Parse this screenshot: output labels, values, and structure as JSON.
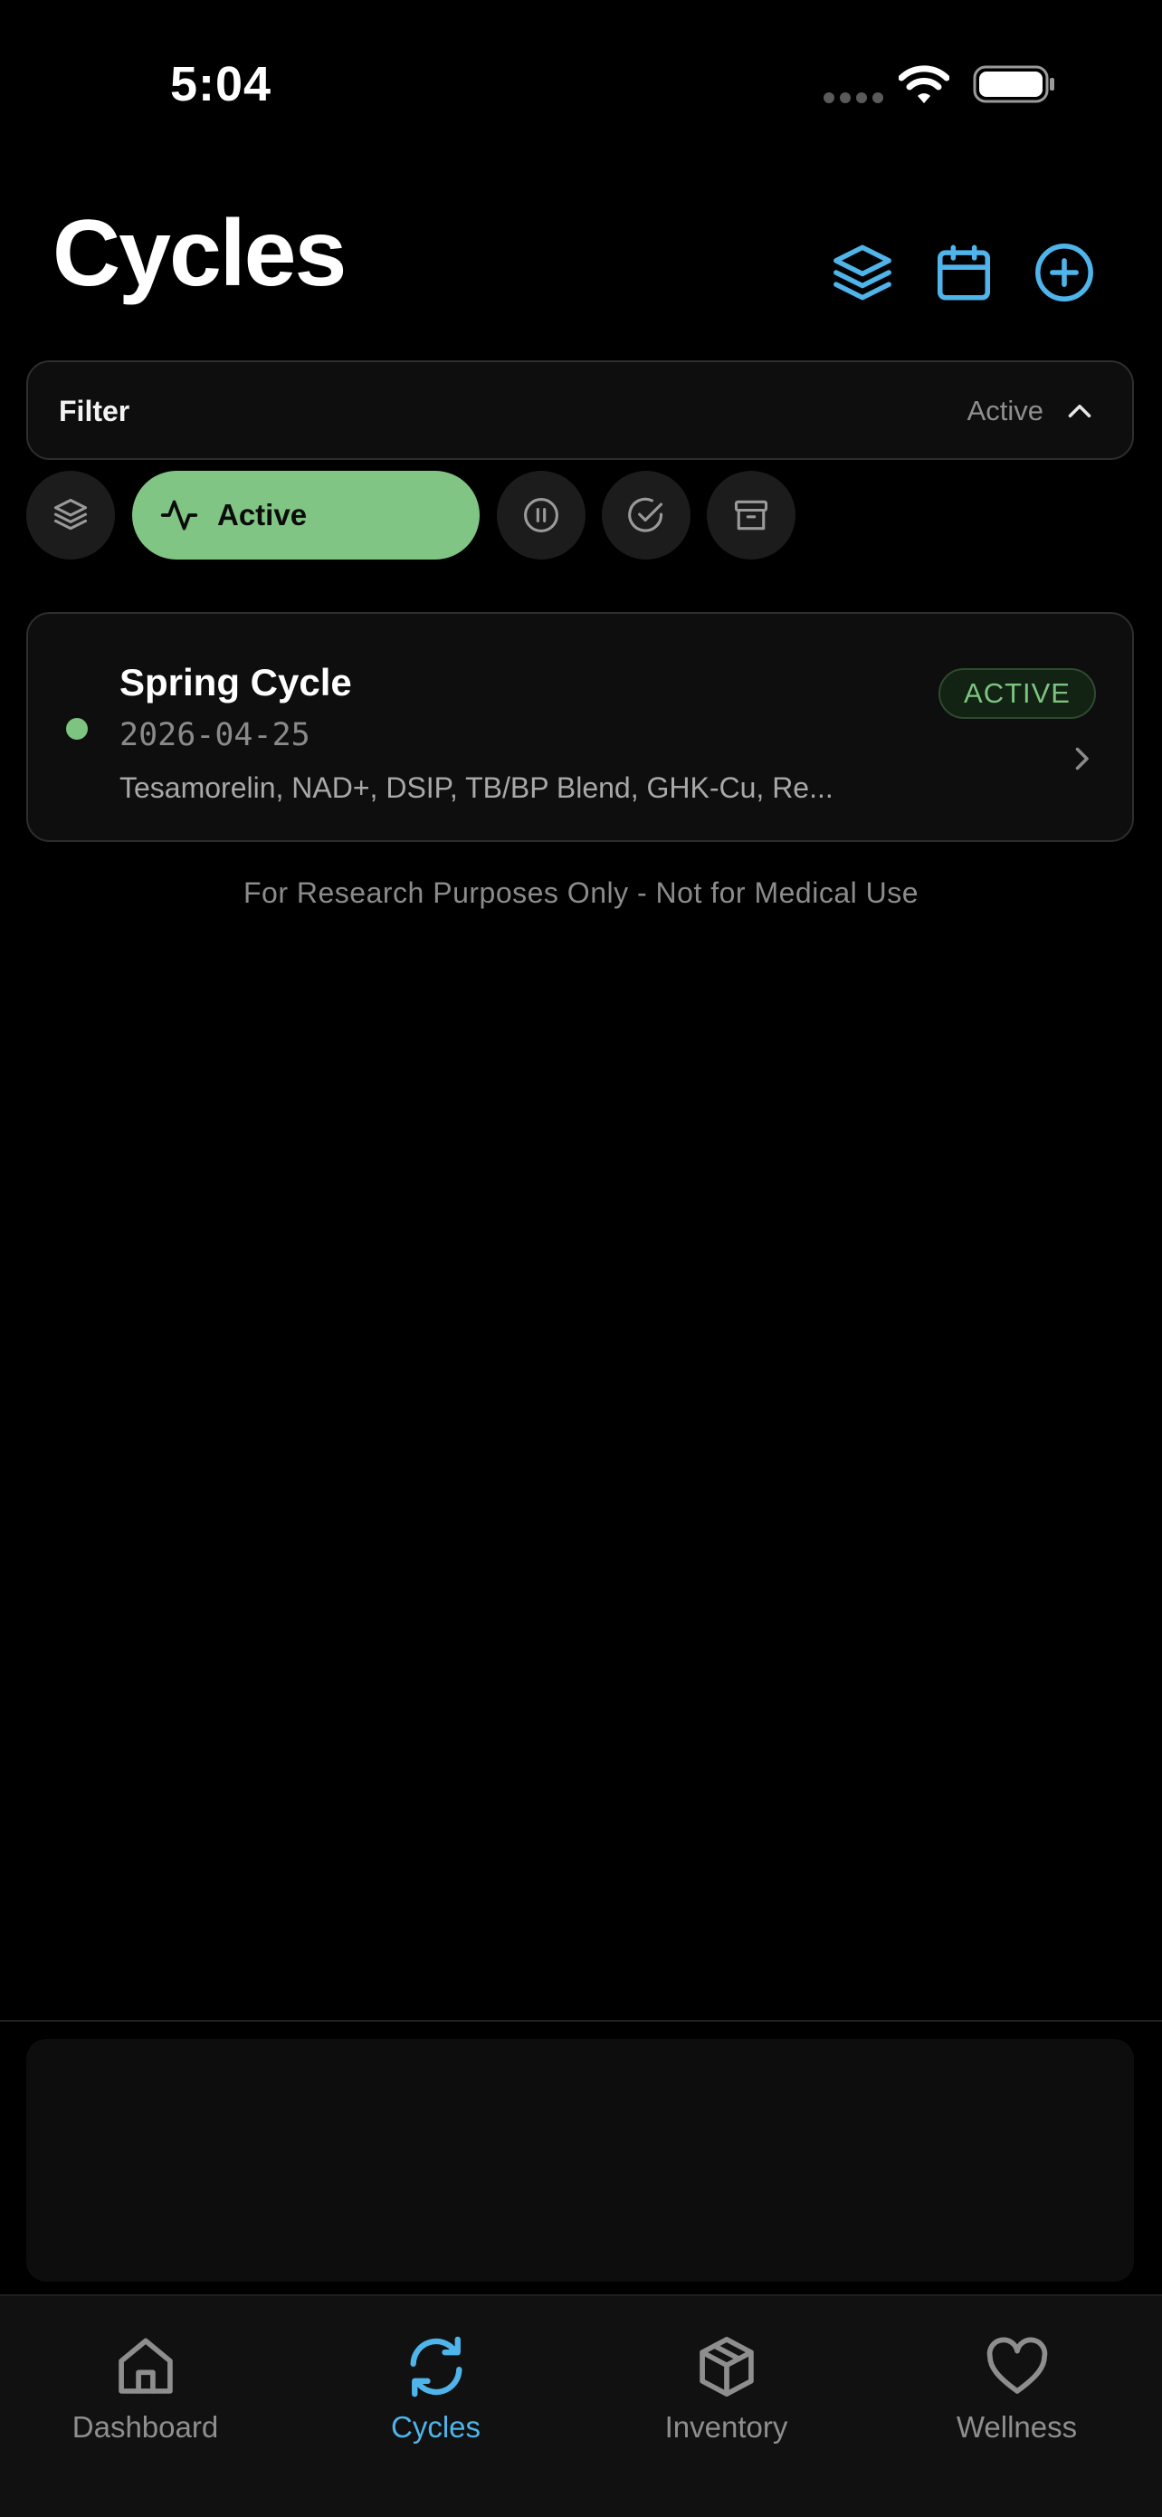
{
  "status_bar": {
    "time": "5:04"
  },
  "header": {
    "title": "Cycles",
    "icons": [
      "layers-icon",
      "calendar-icon",
      "plus-circle-icon"
    ]
  },
  "filter": {
    "label": "Filter",
    "value": "Active"
  },
  "chips": [
    {
      "icon": "layers-icon",
      "label": "",
      "selected": false
    },
    {
      "icon": "activity-icon",
      "label": "Active",
      "selected": true
    },
    {
      "icon": "pause-circle-icon",
      "label": "",
      "selected": false
    },
    {
      "icon": "check-circle-icon",
      "label": "",
      "selected": false
    },
    {
      "icon": "archive-icon",
      "label": "",
      "selected": false
    }
  ],
  "cycles": [
    {
      "name": "Spring Cycle",
      "date": "2026-04-25",
      "items": "Tesamorelin, NAD+, DSIP, TB/BP Blend, GHK-Cu, Re...",
      "status": "ACTIVE"
    }
  ],
  "disclaimer": "For Research Purposes Only - Not for Medical Use",
  "tabs": [
    {
      "label": "Dashboard",
      "icon": "home-icon",
      "selected": false
    },
    {
      "label": "Cycles",
      "icon": "refresh-icon",
      "selected": true
    },
    {
      "label": "Inventory",
      "icon": "box-icon",
      "selected": false
    },
    {
      "label": "Wellness",
      "icon": "heart-icon",
      "selected": false
    }
  ],
  "colors": {
    "accent": "#4fb4ea",
    "active_green": "#80c583",
    "background": "#000000"
  }
}
